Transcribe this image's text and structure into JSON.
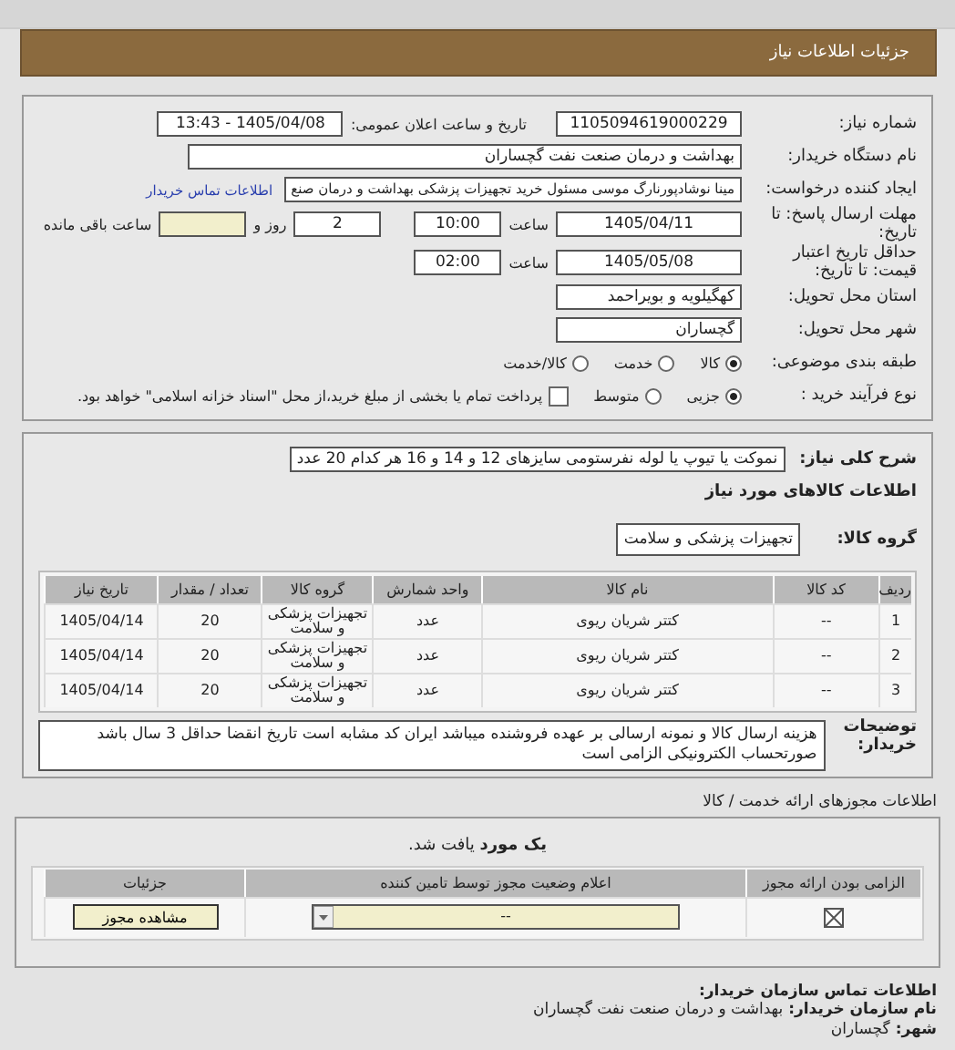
{
  "header": {
    "title": "جزئیات اطلاعات نیاز"
  },
  "details": {
    "need_number": {
      "label": "شماره نیاز:",
      "value": "1105094619000229"
    },
    "announce": {
      "label": "تاریخ و ساعت اعلان عمومی:",
      "value": "1405/04/08 - 13:43"
    },
    "buyer": {
      "label": "نام دستگاه خریدار:",
      "value": "بهداشت و درمان صنعت نفت گچساران"
    },
    "requester": {
      "label": "ایجاد کننده درخواست:",
      "value": "مینا نوشادپورنارگ موسی مسئول خرید تجهیزات پزشکی  بهداشت و درمان صنع",
      "link": "اطلاعات تماس خریدار"
    },
    "deadline": {
      "label": "مهلت ارسال پاسخ: تا تاریخ:",
      "date": "1405/04/11",
      "time_label": "ساعت",
      "time": "10:00",
      "days": "2",
      "days_label": "روز و",
      "hours_label": "ساعت باقی مانده"
    },
    "validity": {
      "label": "حداقل تاریخ اعتبار قیمت: تا تاریخ:",
      "date": "1405/05/08",
      "time_label": "ساعت",
      "time": "02:00"
    },
    "province": {
      "label": "استان محل تحویل:",
      "value": "کهگیلویه و بویراحمد"
    },
    "city": {
      "label": "شهر محل تحویل:",
      "value": "گچساران"
    },
    "category": {
      "label": "طبقه بندی موضوعی:",
      "options": [
        {
          "label": "کالا",
          "selected": true
        },
        {
          "label": "خدمت",
          "selected": false
        },
        {
          "label": "کالا/خدمت",
          "selected": false
        }
      ]
    },
    "process": {
      "label": "نوع فرآیند خرید :",
      "options": [
        {
          "label": "جزیی",
          "selected": true
        },
        {
          "label": "متوسط",
          "selected": false
        }
      ],
      "payment": {
        "checked": false,
        "label": "پرداخت تمام یا بخشی از مبلغ خرید،از محل \"اسناد خزانه اسلامی\" خواهد بود."
      }
    }
  },
  "need": {
    "summary_label": "شرح کلی نیاز:",
    "summary": "نموکت یا تیوپ یا لوله نفرستومی سایزهای 12 و 14 و 16 هر کدام 20 عدد",
    "goods_heading": "اطلاعات کالاهای مورد نیاز",
    "group_label": "گروه کالا:",
    "group": "تجهیزات پزشکی و سلامت",
    "table": {
      "columns": [
        "ردیف",
        "کد کالا",
        "نام کالا",
        "واحد شمارش",
        "گروه کالا",
        "تعداد / مقدار",
        "تاریخ نیاز"
      ],
      "rows": [
        [
          "1",
          "--",
          "کتتر شریان ریوی",
          "عدد",
          "تجهیزات پزشکی و سلامت",
          "20",
          "1405/04/14"
        ],
        [
          "2",
          "--",
          "کتتر شریان ریوی",
          "عدد",
          "تجهیزات پزشکی و سلامت",
          "20",
          "1405/04/14"
        ],
        [
          "3",
          "--",
          "کتتر شریان ریوی",
          "عدد",
          "تجهیزات پزشکی و سلامت",
          "20",
          "1405/04/14"
        ]
      ]
    },
    "notes_label": "توضیحات خریدار:",
    "notes": "هزینه ارسال کالا و نمونه ارسالی بر عهده فروشنده میباشد ایران کد مشابه است تاریخ انقضا حداقل 3 سال باشد صورتحساب الکترونیکی الزامی است"
  },
  "licenses": {
    "title": "اطلاعات مجوزهای ارائه خدمت / کالا",
    "found": "**یک مورد** یافت شد.",
    "columns": [
      "الزامی بودن ارائه مجوز",
      "اعلام وضعیت مجوز توسط تامین کننده",
      "جزئیات"
    ],
    "rows": [
      {
        "required": true,
        "status": "--",
        "action": "مشاهده مجوز"
      }
    ]
  },
  "contact": {
    "title": "اطلاعات تماس سازمان خریدار:",
    "items": [
      {
        "label": "نام سازمان خریدار:",
        "value": "بهداشت و درمان صنعت نفت گچساران"
      },
      {
        "label": "شهر:",
        "value": "گچساران"
      }
    ]
  }
}
